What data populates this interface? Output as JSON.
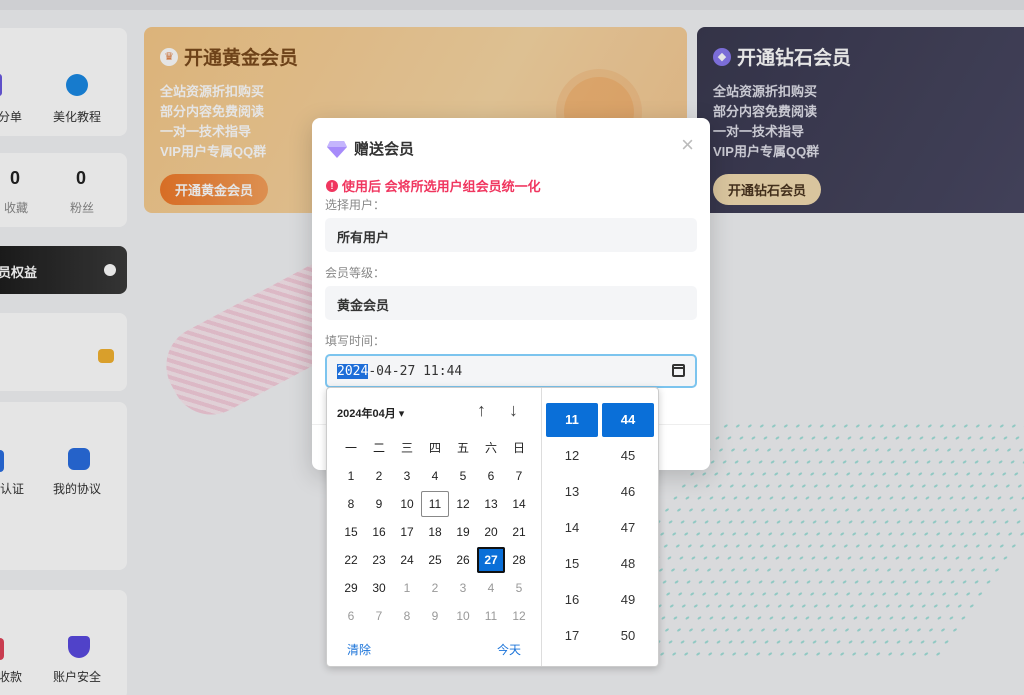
{
  "background": {
    "left_labels": [
      "分单",
      "美化教程"
    ],
    "stats": [
      {
        "num": "0",
        "label": "收藏"
      },
      {
        "num": "0",
        "label": "粉丝"
      }
    ],
    "benefit_label": "员权益",
    "menu_labels": [
      "认证",
      "我的协议"
    ],
    "bottom_labels": [
      "收款",
      "账户安全"
    ]
  },
  "vip_gold": {
    "title": "开通黄金会员",
    "lines": [
      "全站资源折扣购买",
      "部分内容免费阅读",
      "一对一技术指导",
      "VIP用户专属QQ群"
    ],
    "button": "开通黄金会员"
  },
  "vip_diamond": {
    "title": "开通钻石会员",
    "lines": [
      "全站资源折扣购买",
      "部分内容免费阅读",
      "一对一技术指导",
      "VIP用户专属QQ群"
    ],
    "button": "开通钻石会员"
  },
  "dialog": {
    "title": "赠送会员",
    "close": "×",
    "warning": "使用后 会将所选用户组会员统一化",
    "user_label": "选择用户：",
    "user_value": "所有用户",
    "level_label": "会员等级：",
    "level_value": "黄金会员",
    "time_label": "填写时间：",
    "date_year": "2024",
    "date_rest": "-04-27 11:44"
  },
  "picker": {
    "month_label": "2024年04月 ▾",
    "up_arrow": "↑",
    "down_arrow": "↓",
    "weekdays": [
      "一",
      "二",
      "三",
      "四",
      "五",
      "六",
      "日"
    ],
    "days": [
      [
        "1",
        "2",
        "3",
        "4",
        "5",
        "6",
        "7"
      ],
      [
        "8",
        "9",
        "10",
        "11",
        "12",
        "13",
        "14"
      ],
      [
        "15",
        "16",
        "17",
        "18",
        "19",
        "20",
        "21"
      ],
      [
        "22",
        "23",
        "24",
        "25",
        "26",
        "27",
        "28"
      ],
      [
        "29",
        "30",
        "1",
        "2",
        "3",
        "4",
        "5"
      ],
      [
        "6",
        "7",
        "8",
        "9",
        "10",
        "11",
        "12"
      ]
    ],
    "today": "11",
    "selected": "27",
    "clear": "清除",
    "today_btn": "今天",
    "hours": [
      "11",
      "12",
      "13",
      "14",
      "15",
      "16",
      "17"
    ],
    "minutes": [
      "44",
      "45",
      "46",
      "47",
      "48",
      "49",
      "50"
    ]
  }
}
